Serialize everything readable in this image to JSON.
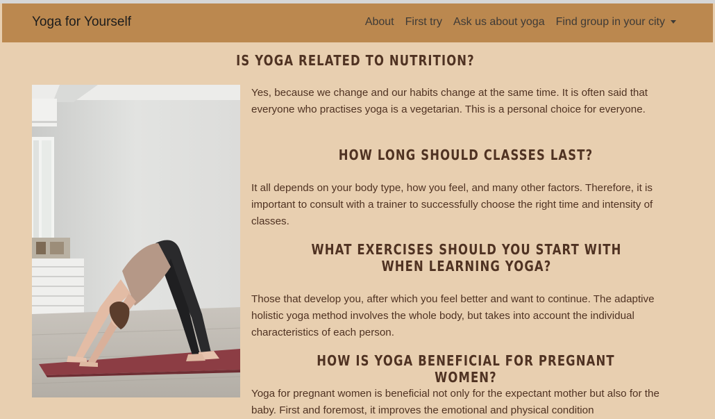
{
  "navbar": {
    "brand": "Yoga for Yourself",
    "links": [
      "About",
      "First try",
      "Ask us about yoga",
      "Find group in your city"
    ],
    "bg_color": "#bb884f"
  },
  "page": {
    "bg_color": "#e8cfb0",
    "text_color": "#4f3222"
  },
  "sections": [
    {
      "heading": "IS YOGA RELATED TO NUTRITION?",
      "text": "Yes, because we change and our habits change at the same time. It is often said that everyone who practises yoga is a vegetarian. This is a personal choice for everyone."
    },
    {
      "heading": "HOW LONG SHOULD CLASSES LAST?",
      "text": "It all depends on your body type, how you feel, and many other factors. Therefore, it is important to consult with a trainer to successfully choose the right time and intensity of classes."
    },
    {
      "heading": "WHAT EXERCISES SHOULD YOU START WITH WHEN LEARNING YOGA?",
      "text": "Those that develop you, after which you feel better and want to continue. The adaptive holistic yoga method involves the whole body, but takes into account the individual characteristics of each person."
    },
    {
      "heading": "HOW IS YOGA BENEFICIAL FOR PREGNANT WOMEN?",
      "text": "Yoga for pregnant women is beneficial not only for the expectant mother but also for the baby. First and foremost, it improves the emotional and physical condition"
    }
  ],
  "image": {
    "icon": "yoga-downward-dog-photo"
  }
}
